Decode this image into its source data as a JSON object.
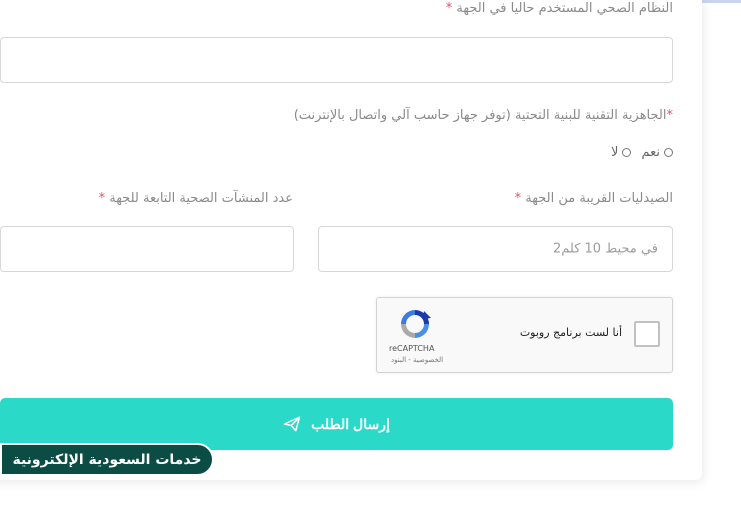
{
  "form": {
    "health_system_label": "النظام الصحي المستخدم حاليا في الجهة",
    "infrastructure_label": "الجاهزية التقنية للبنية التحتية (توفر جهاز حاسب آلي واتصال بالإنترنت)",
    "radio_yes": "نعم",
    "radio_no": "لا",
    "pharmacies_label": "الصيدليات القريبة من الجهة",
    "pharmacies_placeholder": "في محيط 10 كلم2",
    "facilities_label": "عدد المنشآت الصحية التابعة للجهة",
    "required_mark": "*",
    "submit_label": "إرسال الطلب"
  },
  "captcha": {
    "checkbox_label": "أنا لست برنامج روبوت",
    "brand": "reCAPTCHA",
    "links": "الخصوصية - البنود"
  },
  "watermark": {
    "text": "خدمات السعودية الإلكترونية"
  },
  "colors": {
    "accent": "#2bd9c9",
    "badge_bg": "#0b4c45",
    "required": "#e0526b"
  }
}
